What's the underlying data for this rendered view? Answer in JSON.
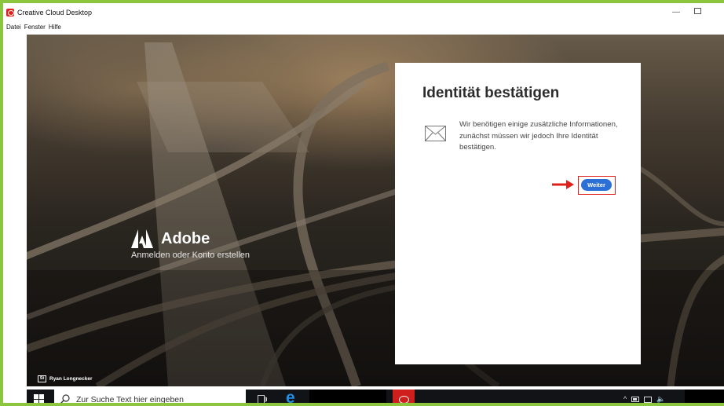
{
  "window": {
    "title": "Creative Cloud Desktop",
    "controls": {
      "minimize": "—"
    }
  },
  "menu": {
    "items": [
      "Datei",
      "Fenster",
      "Hilfe"
    ]
  },
  "brand": {
    "name": "Adobe",
    "tagline": "Anmelden oder Konto erstellen"
  },
  "photo_credit": {
    "icon_text": "St",
    "name": "Ryan Longnecker"
  },
  "dialog": {
    "title": "Identität bestätigen",
    "message": "Wir benötigen einige zusätzliche Informationen, zunächst müssen wir jedoch Ihre Identität bestätigen.",
    "continue_button": "Weiter",
    "icon": "mail-icon"
  },
  "colors": {
    "accent": "#2c6fd6",
    "highlight": "#e0201b",
    "frame": "#8cc63f",
    "taskbar": "#111316",
    "adobe_red": "#cf1f1c"
  },
  "taskbar": {
    "search_placeholder": "Zur Suche Text hier eingeben",
    "edge_glyph": "e",
    "volume_glyph": "🔈"
  }
}
